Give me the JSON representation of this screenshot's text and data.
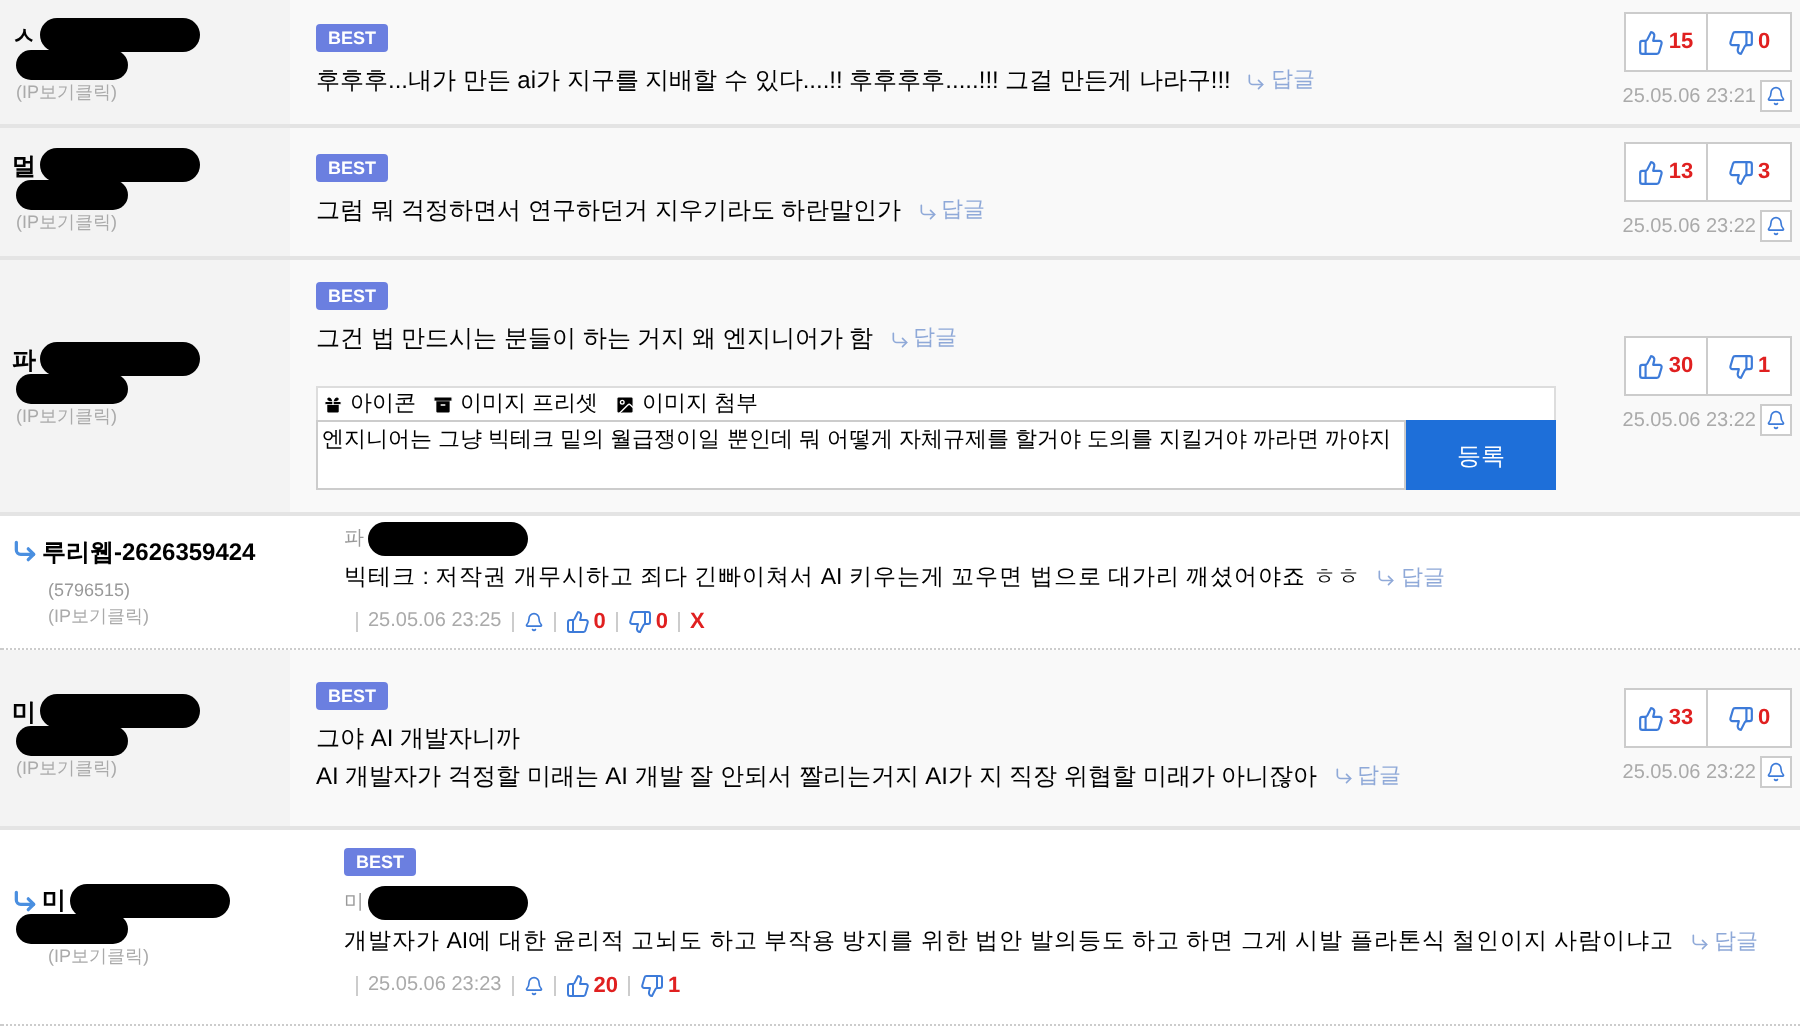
{
  "comments": [
    {
      "kind": "comment",
      "author": "ㅅ",
      "ip": "(IP보기클릭)",
      "best": true,
      "badge": "BEST",
      "lines": [
        "후후후...내가 만든 ai가 지구를 지배할 수 있다....!! 후후후후.....!!! 그걸 만든게 나라구!!!"
      ],
      "reply_link": "답글",
      "up": "15",
      "down": "0",
      "time": "25.05.06 23:21"
    },
    {
      "kind": "comment",
      "author": "멀",
      "ip": "(IP보기클릭)",
      "best": true,
      "badge": "BEST",
      "lines": [
        "그럼 뭐 걱정하면서 연구하던거 지우기라도 하란말인가"
      ],
      "reply_link": "답글",
      "up": "13",
      "down": "3",
      "time": "25.05.06 23:22"
    },
    {
      "kind": "comment",
      "author": "파",
      "ip": "(IP보기클릭)",
      "best": true,
      "badge": "BEST",
      "lines": [
        "그건 법 만드시는 분들이 하는 거지 왜 엔지니어가 함"
      ],
      "reply_link": "답글",
      "up": "30",
      "down": "1",
      "time": "25.05.06 23:22",
      "reply_form": {
        "tools": [
          {
            "kind": "gift",
            "label": "아이콘"
          },
          {
            "kind": "box",
            "label": "이미지 프리셋"
          },
          {
            "kind": "image",
            "label": "이미지 첨부"
          }
        ],
        "value": "엔지니어는 그냥 빅테크 밑의 월급쟁이일 뿐인데 뭐 어떻게 자체규제를 할거야 도의를 지킬거야 까라면 까야지",
        "submit": "등록"
      }
    },
    {
      "kind": "reply",
      "author": "루리웹-2626359424",
      "member_id": "(5796515)",
      "ip": "(IP보기클릭)",
      "quote_author": "파",
      "lines": [
        "빅테크 : 저작권 개무시하고 죄다 긴빠이쳐서 AI 키우는게 꼬우면 법으로 대가리 깨셨어야죠 ㅎㅎ"
      ],
      "reply_link": "답글",
      "time": "25.05.06 23:25",
      "up": "0",
      "down": "0",
      "delete": "X"
    },
    {
      "kind": "comment",
      "author": "미",
      "ip": "(IP보기클릭)",
      "best": true,
      "badge": "BEST",
      "lines": [
        "그야 AI 개발자니까",
        "AI 개발자가 걱정할 미래는 AI 개발 잘 안되서 짤리는거지 AI가 지 직장 위협할 미래가 아니잖아"
      ],
      "reply_link": "답글",
      "up": "33",
      "down": "0",
      "time": "25.05.06 23:22"
    },
    {
      "kind": "reply",
      "author": "미",
      "ip": "(IP보기클릭)",
      "best": true,
      "badge": "BEST",
      "quote_author": "미",
      "lines": [
        "개발자가 AI에 대한 윤리적 고뇌도 하고 부작용 방지를 위한 법안 발의등도 하고 하면 그게 시발 플라톤식 철인이지 사람이냐고"
      ],
      "reply_link": "답글",
      "time": "25.05.06 23:23",
      "up": "20",
      "down": "1"
    }
  ]
}
